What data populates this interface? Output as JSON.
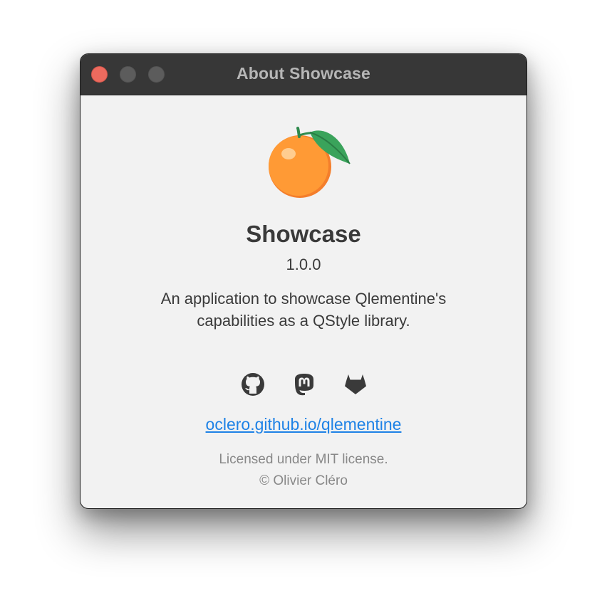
{
  "window": {
    "title": "About Showcase",
    "controls": {
      "close": "close",
      "minimize": "minimize",
      "zoom": "zoom"
    }
  },
  "app": {
    "name": "Showcase",
    "version": "1.0.0",
    "description_line1": "An application to showcase Qlementine's",
    "description_line2": "capabilities as a QStyle library.",
    "logo_icon": "tangerine-icon"
  },
  "social": [
    {
      "name": "github-icon"
    },
    {
      "name": "mastodon-icon"
    },
    {
      "name": "gitlab-icon"
    }
  ],
  "link": {
    "text": "oclero.github.io/qlementine"
  },
  "license": {
    "line1": "Licensed under MIT license.",
    "line2": "© Olivier Cléro"
  },
  "colors": {
    "titlebar": "#373737",
    "background": "#f2f2f2",
    "link": "#1e82e6",
    "close_button": "#ed6a5e",
    "icon": "#3a3a3a"
  }
}
